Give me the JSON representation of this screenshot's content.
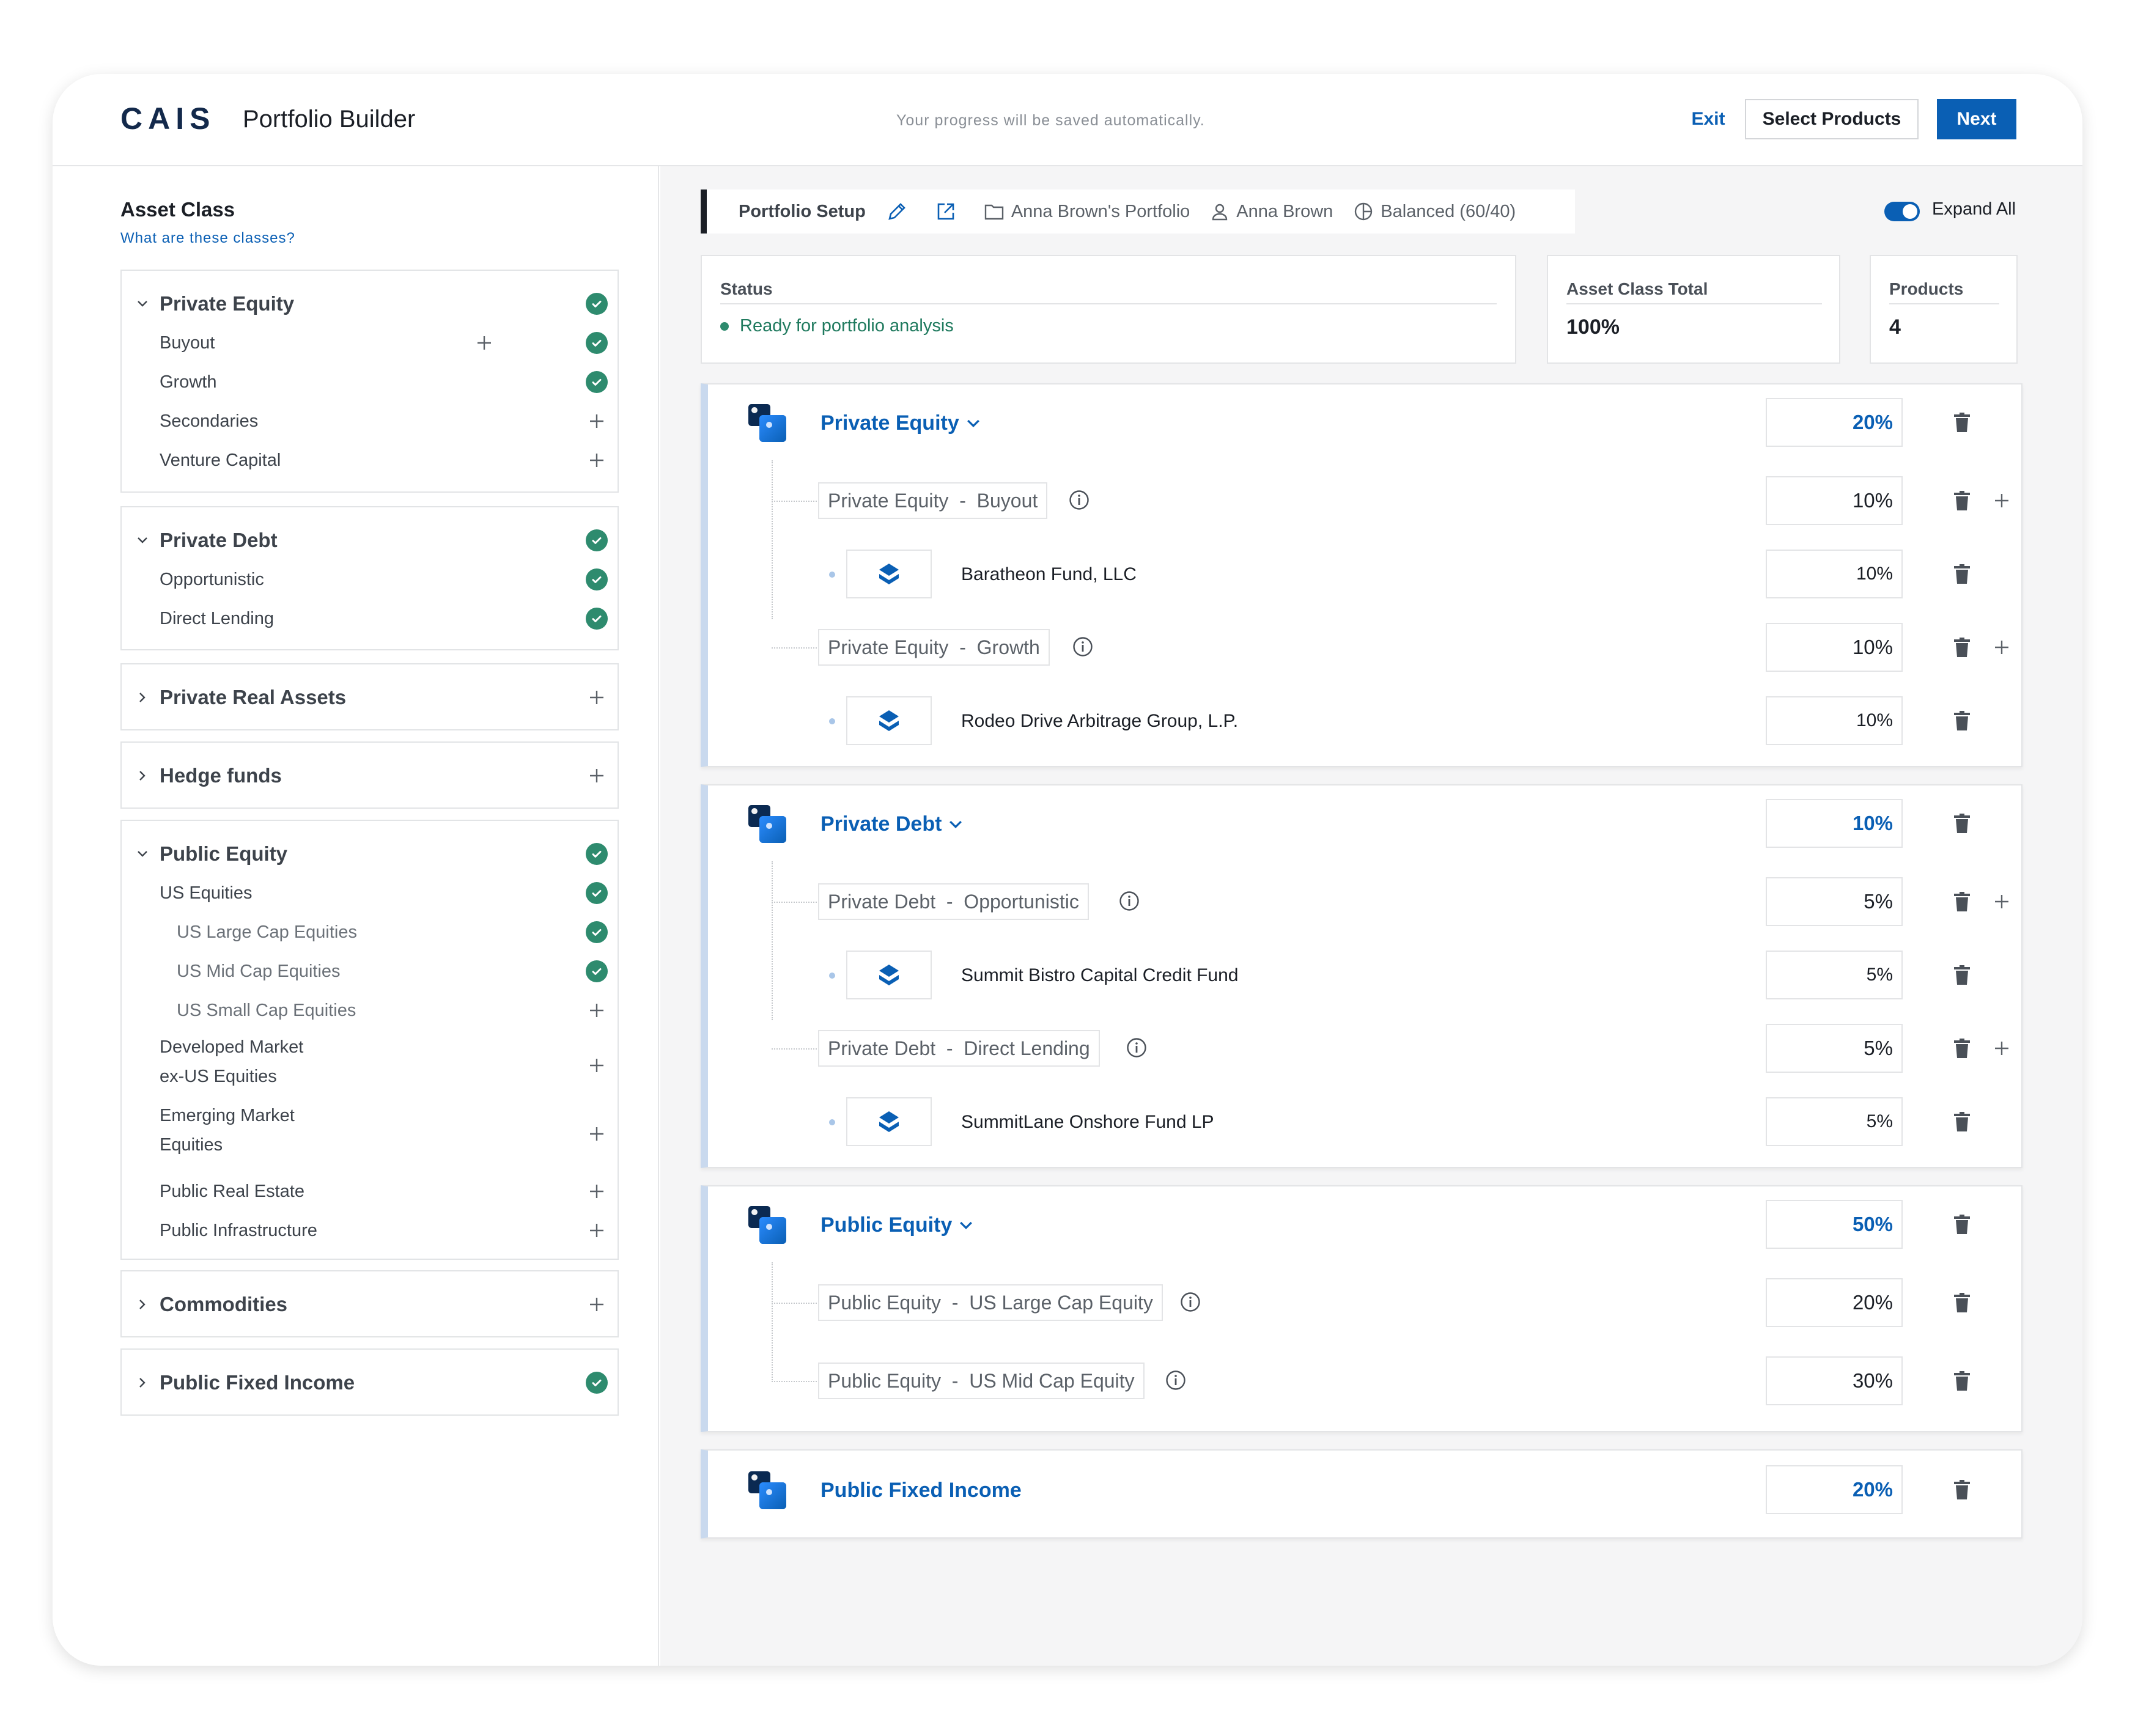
{
  "header": {
    "logo": "CAIS",
    "title": "Portfolio Builder",
    "save_message": "Your progress will be saved automatically.",
    "exit_label": "Exit",
    "select_products_label": "Select Products",
    "next_label": "Next"
  },
  "sidebar": {
    "title": "Asset Class",
    "help_link": "What are these classes?",
    "groups": [
      {
        "label": "Private Equity",
        "expanded": true,
        "selected": true,
        "items": [
          {
            "label": "Buyout",
            "selected": true
          },
          {
            "label": "Growth",
            "selected": true
          },
          {
            "label": "Secondaries",
            "selected": false
          },
          {
            "label": "Venture Capital",
            "selected": false
          }
        ]
      },
      {
        "label": "Private Debt",
        "expanded": true,
        "selected": true,
        "items": [
          {
            "label": "Opportunistic",
            "selected": true
          },
          {
            "label": "Direct Lending",
            "selected": true
          }
        ]
      },
      {
        "label": "Private Real Assets",
        "expanded": false,
        "selected": false,
        "items": []
      },
      {
        "label": "Hedge funds",
        "expanded": false,
        "selected": false,
        "items": []
      },
      {
        "label": "Public Equity",
        "expanded": true,
        "selected": true,
        "items": [
          {
            "label": "US Equities",
            "selected": true
          },
          {
            "label": "US Large Cap Equities",
            "selected": true
          },
          {
            "label": "US Mid Cap Equities",
            "selected": true
          },
          {
            "label": "US Small Cap Equities",
            "selected": false
          },
          {
            "label": "Developed Market",
            "label2": "ex-US Equities",
            "selected": false
          },
          {
            "label": "Emerging Market",
            "label2": "Equities",
            "selected": false
          },
          {
            "label": "Public Real Estate",
            "selected": false
          },
          {
            "label": "Public Infrastructure",
            "selected": false
          }
        ]
      },
      {
        "label": "Commodities",
        "expanded": false,
        "selected": false,
        "items": []
      },
      {
        "label": "Public Fixed Income",
        "expanded": false,
        "selected": true,
        "items": []
      }
    ]
  },
  "setup": {
    "label": "Portfolio Setup",
    "portfolio_name": "Anna Brown's Portfolio",
    "client": "Anna Brown",
    "risk": "Balanced (60/40)",
    "expand_all": "Expand All"
  },
  "summary": {
    "status_title": "Status",
    "status_value": "Ready for portfolio analysis",
    "total_title": "Asset Class Total",
    "total_value": "100%",
    "products_title": "Products",
    "products_value": "4"
  },
  "allocations": [
    {
      "name": "Private Equity",
      "value": "20%",
      "subs": [
        {
          "class": "Private Equity",
          "sub": "Buyout",
          "value": "10%",
          "fund": "Baratheon Fund, LLC",
          "fund_value": "10%"
        },
        {
          "class": "Private Equity",
          "sub": "Growth",
          "value": "10%",
          "fund": "Rodeo Drive Arbitrage Group, L.P.",
          "fund_value": "10%"
        }
      ]
    },
    {
      "name": "Private Debt",
      "value": "10%",
      "subs": [
        {
          "class": "Private Debt",
          "sub": "Opportunistic",
          "value": "5%",
          "fund": "Summit Bistro Capital Credit Fund",
          "fund_value": "5%"
        },
        {
          "class": "Private Debt",
          "sub": "Direct Lending",
          "value": "5%",
          "fund": "SummitLane Onshore Fund LP",
          "fund_value": "5%"
        }
      ]
    },
    {
      "name": "Public Equity",
      "value": "50%",
      "subs": [
        {
          "class": "Public Equity",
          "sub": "US Large Cap Equity",
          "value": "20%"
        },
        {
          "class": "Public Equity",
          "sub": "US Mid Cap Equity",
          "value": "30%"
        }
      ]
    },
    {
      "name": "Public Fixed Income",
      "value": "20%",
      "subs": []
    }
  ],
  "colors": {
    "accent": "#0a5fb4",
    "success": "#2e8b6e",
    "navy": "#13294b"
  }
}
